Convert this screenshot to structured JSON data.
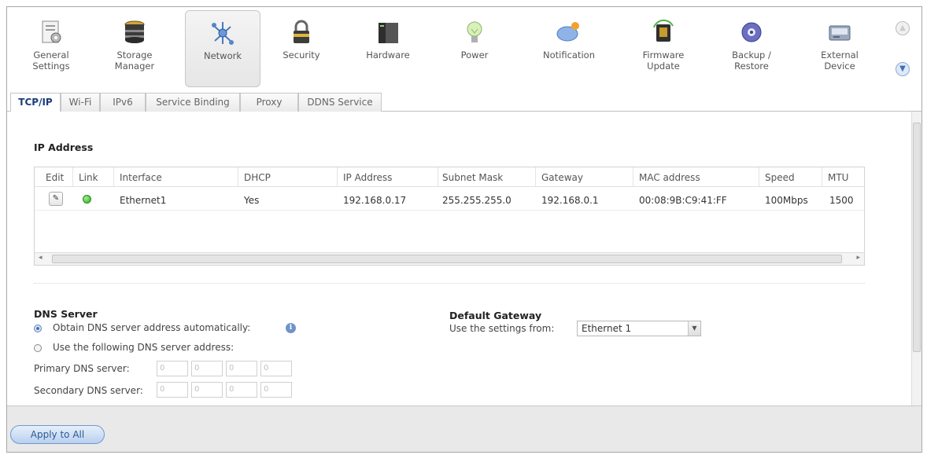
{
  "nav": {
    "items": [
      {
        "label": "General\nSettings",
        "icon": "general-settings-icon"
      },
      {
        "label": "Storage\nManager",
        "icon": "storage-manager-icon"
      },
      {
        "label": "Network",
        "icon": "network-icon"
      },
      {
        "label": "Security",
        "icon": "lock-icon"
      },
      {
        "label": "Hardware",
        "icon": "hardware-icon"
      },
      {
        "label": "Power",
        "icon": "lightbulb-icon"
      },
      {
        "label": "Notification",
        "icon": "notification-icon"
      },
      {
        "label": "Firmware\nUpdate",
        "icon": "firmware-icon"
      },
      {
        "label": "Backup /\nRestore",
        "icon": "backup-restore-icon"
      },
      {
        "label": "External\nDevice",
        "icon": "external-device-icon"
      }
    ],
    "active": "Network"
  },
  "tabs": [
    {
      "label": "TCP/IP",
      "active": true
    },
    {
      "label": "Wi-Fi",
      "active": false
    },
    {
      "label": "IPv6",
      "active": false
    },
    {
      "label": "Service Binding",
      "active": false
    },
    {
      "label": "Proxy",
      "active": false
    },
    {
      "label": "DDNS Service",
      "active": false
    }
  ],
  "ip_section": {
    "title": "IP Address",
    "columns": [
      "Edit",
      "Link",
      "Interface",
      "DHCP",
      "IP Address",
      "Subnet Mask",
      "Gateway",
      "MAC address",
      "Speed",
      "MTU"
    ],
    "rows": [
      {
        "interface": "Ethernet1",
        "dhcp": "Yes",
        "ip": "192.168.0.17",
        "mask": "255.255.255.0",
        "gateway": "192.168.0.1",
        "mac": "00:08:9B:C9:41:FF",
        "speed": "100Mbps",
        "mtu": "1500",
        "link_color": "#2fa823"
      }
    ]
  },
  "dns": {
    "title": "DNS Server",
    "auto_label": "Obtain DNS server address automatically:",
    "manual_label": "Use the following DNS server address:",
    "selected": "auto",
    "primary_label": "Primary DNS server:",
    "secondary_label": "Secondary DNS server:",
    "primary_values": [
      "0",
      "0",
      "0",
      "0"
    ],
    "secondary_values": [
      "0",
      "0",
      "0",
      "0"
    ]
  },
  "gateway": {
    "title": "Default Gateway",
    "label": "Use the settings from:",
    "value": "Ethernet 1"
  },
  "footer": {
    "apply_label": "Apply to All"
  },
  "colors": {
    "accent": "#3b6fb5",
    "link_up": "#2fa823"
  }
}
